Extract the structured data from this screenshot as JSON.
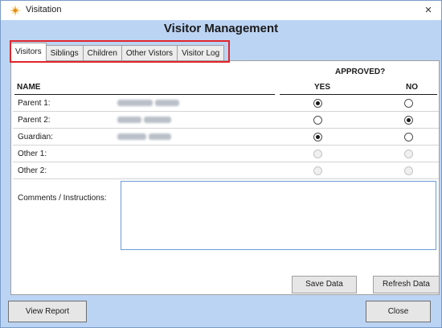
{
  "window": {
    "title": "Visitation",
    "close_glyph": "×"
  },
  "header": {
    "title": "Visitor Management"
  },
  "tabs": [
    {
      "label": "Visitors",
      "active": true
    },
    {
      "label": "Siblings",
      "active": false
    },
    {
      "label": "Children",
      "active": false
    },
    {
      "label": "Other Vistors",
      "active": false
    },
    {
      "label": "Visitor Log",
      "active": false
    }
  ],
  "table": {
    "approved_header": "APPROVED?",
    "name_header": "NAME",
    "yes_header": "YES",
    "no_header": "NO",
    "rows": [
      {
        "label": "Parent 1:",
        "approved": "yes",
        "enabled": true
      },
      {
        "label": "Parent 2:",
        "approved": "no",
        "enabled": true
      },
      {
        "label": "Guardian:",
        "approved": "yes",
        "enabled": true
      },
      {
        "label": "Other 1:",
        "approved": "",
        "enabled": false
      },
      {
        "label": "Other 2:",
        "approved": "",
        "enabled": false
      }
    ]
  },
  "comments": {
    "label": "Comments / Instructions:",
    "value": ""
  },
  "buttons": {
    "save": "Save Data",
    "refresh": "Refresh Data",
    "view_report": "View Report",
    "close": "Close"
  },
  "colors": {
    "window_bg": "#bcd4f4",
    "tab_highlight": "#e0262c",
    "icon_star": "#f2b43a"
  }
}
